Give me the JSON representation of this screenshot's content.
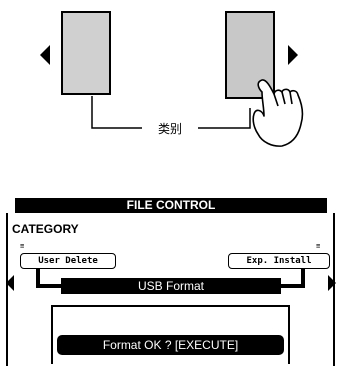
{
  "illustration": {
    "category_label": "类别"
  },
  "lcd": {
    "header": "FILE CONTROL",
    "category": "CATEGORY",
    "left_item": "User Delete",
    "right_item": "Exp. Install",
    "left_tick": "≡",
    "right_tick": "≡",
    "bar_title": "USB Format",
    "confirm": "Format OK ? [EXECUTE]"
  }
}
